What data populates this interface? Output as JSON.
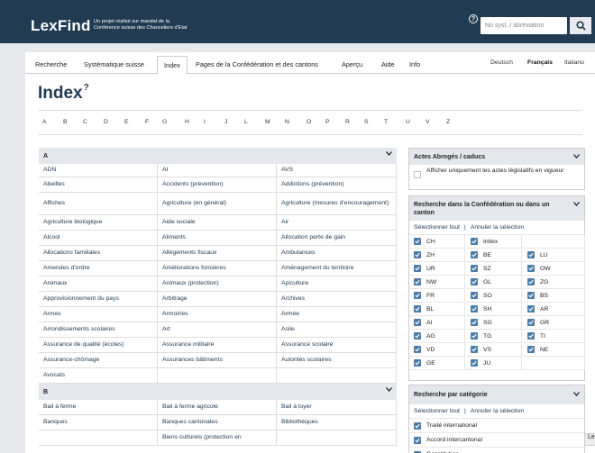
{
  "header": {
    "logo": "LexFind",
    "tagline_1": "Un projet réalisé sur mandat de la",
    "tagline_2": "Conférence suisse des Chanceliers d'Etat",
    "help_symbol": "?",
    "search_placeholder": "No syst. / abréviation"
  },
  "nav": {
    "items": [
      "Recherche",
      "Systématique suisse",
      "Index",
      "Pages de la Confédération et des cantons",
      "Aperçu",
      "Aide",
      "Info"
    ],
    "active": "Index",
    "languages": [
      "Deutsch",
      "Français",
      "Italiano"
    ],
    "selected_language": "Français"
  },
  "page": {
    "title": "Index",
    "title_help": "?"
  },
  "alphabet": [
    "A",
    "B",
    "C",
    "D",
    "E",
    "F",
    "G",
    "H",
    "I",
    "J",
    "L",
    "M",
    "N",
    "O",
    "P",
    "R",
    "S",
    "T",
    "U",
    "V",
    "Z"
  ],
  "index": {
    "groups": [
      {
        "letter": "A",
        "rows": [
          [
            "ADN",
            "AI",
            "AVS"
          ],
          [
            "Abeilles",
            "Accidents (prévention)",
            "Addictions (prévention)"
          ],
          [
            "Affiches",
            "Agriculture (en général)",
            "Agriculture (mesures d'encouragement)"
          ],
          [
            "Agriculture biologique",
            "Aide sociale",
            "Air"
          ],
          [
            "Alcool",
            "Aliments",
            "Allocation perte de gain"
          ],
          [
            "Allocations familiales",
            "Allégements fiscaux",
            "Ambulances"
          ],
          [
            "Amendes d'ordre",
            "Améliorations foncières",
            "Aménagement du territoire"
          ],
          [
            "Animaux",
            "Animaux (protection)",
            "Apiculture"
          ],
          [
            "Approvisionnement du pays",
            "Arbitrage",
            "Archives"
          ],
          [
            "Armes",
            "Armoiries",
            "Armée"
          ],
          [
            "Arrondissements scolaires",
            "Art",
            "Asile"
          ],
          [
            "Assurance de qualité (écoles)",
            "Assurance militaire",
            "Assurance scolaire"
          ],
          [
            "Assurance-chômage",
            "Assurances bâtiments",
            "Autorités scolaires"
          ],
          [
            "Avocats",
            "",
            ""
          ]
        ]
      },
      {
        "letter": "B",
        "rows": [
          [
            "Bail à ferme",
            "Bail à ferme agricole",
            "Bail à loyer"
          ],
          [
            "Banques",
            "Banques cantonales",
            "Bibliothèques"
          ],
          [
            "",
            "Biens culturels (protection en",
            ""
          ]
        ]
      }
    ]
  },
  "sidebar": {
    "abrogated": {
      "title": "Actes Abrogés / caducs",
      "checkbox_label": "Afficher uniquement les actes législatifs en vigueur"
    },
    "cantons": {
      "title": "Recherche dans la Confédération ou dans un canton",
      "select_all": "Sélectionner tout",
      "separator": "|",
      "clear": "Annuler la sélection",
      "list": [
        [
          "CH",
          "Intlex",
          ""
        ],
        [
          "ZH",
          "BE",
          "LU"
        ],
        [
          "UR",
          "SZ",
          "OW"
        ],
        [
          "NW",
          "GL",
          "ZG"
        ],
        [
          "FR",
          "SO",
          "BS"
        ],
        [
          "BL",
          "SH",
          "AR"
        ],
        [
          "AI",
          "SG",
          "GR"
        ],
        [
          "AG",
          "TG",
          "TI"
        ],
        [
          "VD",
          "VS",
          "NE"
        ],
        [
          "GE",
          "JU",
          ""
        ]
      ]
    },
    "categories": {
      "title": "Recherche par catégorie",
      "select_all": "Sélectionner tout",
      "separator": "|",
      "clear": "Annuler la sélection",
      "items": [
        "Traité international",
        "Accord intercantonal",
        "Constitution"
      ]
    }
  },
  "edge_tab": "Le",
  "colors": {
    "header_bg": "#213b52",
    "link": "#213b52",
    "checkbox": "#4c7da8"
  }
}
